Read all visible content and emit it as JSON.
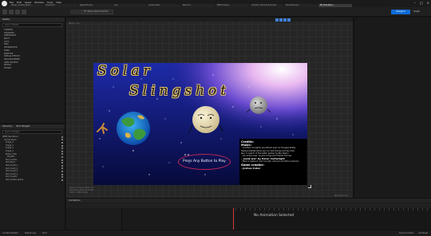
{
  "menu": [
    "File",
    "Edit",
    "Asset",
    "Window",
    "Tools",
    "Help"
  ],
  "tabs": [
    "Player_Credits_Menu",
    "Character",
    "SpawnEnemy",
    "Gun",
    "LevelLoader",
    "Beacon1",
    "BPMiniGame",
    "Variable_Tutorial_Example",
    "PlanetGeneric",
    "BP_MainMenu"
  ],
  "toolbar": {
    "debug_filter": "No debug object selected",
    "designer_label": "Designer",
    "graph_label": "Graph"
  },
  "palette": {
    "title": "Palette",
    "search_placeholder": "Search Palette",
    "categories": [
      "COMMON",
      "ADVANCED",
      "APPEARANCE",
      "INPUT",
      "LISTS",
      "MISC",
      "OPTIMIZATION",
      "PANEL",
      "PRIMITIVE",
      "SPECIAL EFFECTS",
      "UNCATEGORIZED",
      "USER CREATED",
      "EDITOR",
      "WIDGET"
    ]
  },
  "hierarchy": {
    "title": "Hierarchy",
    "tab2": "Bind Widgets",
    "search_placeholder": "Search Widgets",
    "items": [
      "[WBP_MainMenu]",
      "Canvas Panel",
      "Image_0",
      "Image_1",
      "Image_2",
      "Image_3",
      "Button_Title",
      "PlayText",
      "Text_Credits",
      "Text_Music",
      "Text_Credit_1",
      "Text_Credit_2",
      "Text_Credit_3",
      "Text_Credit_4",
      "Text_Creator",
      "Text_Creator_Name"
    ]
  },
  "designer": {
    "zoom": "Zoom -1:1",
    "dpi_lines": [
      "Device Content Scale 1.0",
      "No Device Safe Zone Set",
      "1920 x 1080 (16:9)"
    ],
    "dpi_scale": "DPI Scale 0.67"
  },
  "game": {
    "title_line1": "Solar",
    "title_line2": "Slingshot",
    "play_button": "Press Any Button to Play",
    "credits": {
      "heading": "Credits:",
      "music_heading": "Music:",
      "music_lines": [
        "- 'Another cool game soundtrack ever' by Douglas Kirkby",
        "  freesound/alternative use non-hub license and key links",
        "  also 'In search of the better games' by Ben Melon",
        "- 'we screen ever' by Jack Longe and Charlie Thomas",
        "- 'punk war' by Oscar Cartwright",
        "- 'Next 2 captions' and 'Ice lady' Amount and Shino Lavaclyn"
      ],
      "creator_heading": "Game creator:",
      "creator_name": "- Joshua Coker"
    }
  },
  "animations": {
    "title": "Animations",
    "empty_message": "No Animation Selected"
  },
  "statusbar": {
    "items": [
      "Content Drawer",
      "Output Log",
      "Cmd"
    ],
    "right": [
      "Source Control",
      "All Saved"
    ]
  }
}
